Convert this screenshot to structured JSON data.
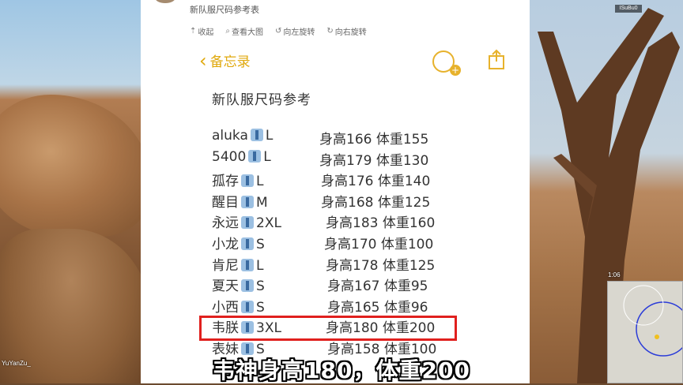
{
  "viewer": {
    "title": "新队服尺码参考表",
    "toolbar": [
      {
        "icon": "collapse-icon",
        "label": "收起"
      },
      {
        "icon": "zoom-icon",
        "label": "查看大图"
      },
      {
        "icon": "rotate-left-icon",
        "label": "向左旋转"
      },
      {
        "icon": "rotate-right-icon",
        "label": "向右旋转"
      }
    ]
  },
  "notes": {
    "back_label": "备忘录",
    "title": "新队服尺码参考",
    "rows": [
      {
        "name": "aluka",
        "size": "L",
        "height": "身高166",
        "weight": "体重155"
      },
      {
        "name": "5400",
        "size": "L",
        "height": "身高179",
        "weight": "体重130"
      },
      {
        "name": "孤存",
        "size": "L",
        "height": "身高176",
        "weight": "体重140"
      },
      {
        "name": "醒目",
        "size": "M",
        "height": "身高168",
        "weight": "体重125"
      },
      {
        "name": "永远",
        "size": "2XL",
        "height": "身高183",
        "weight": "体重160"
      },
      {
        "name": "小龙",
        "size": "S",
        "height": "身高170",
        "weight": "体重100"
      },
      {
        "name": "肯尼",
        "size": "L",
        "height": "身高178",
        "weight": "体重125"
      },
      {
        "name": "夏天",
        "size": "S",
        "height": "身高167",
        "weight": "体重95"
      },
      {
        "name": "小西",
        "size": "S",
        "height": "身高165",
        "weight": "体重96"
      },
      {
        "name": "韦朕",
        "size": "3XL",
        "height": "身高180",
        "weight": "体重200"
      },
      {
        "name": "表妹",
        "size": "S",
        "height": "身高158",
        "weight": "体重100"
      }
    ],
    "highlighted_row_index": 9
  },
  "game_hud": {
    "player_name": "YuYanZu_",
    "timer": "1:06",
    "top_label": "ISuBu0"
  },
  "subtitle": "韦神身高180，体重200",
  "colors": {
    "accent": "#e0a90e",
    "highlight": "#e0201e"
  }
}
